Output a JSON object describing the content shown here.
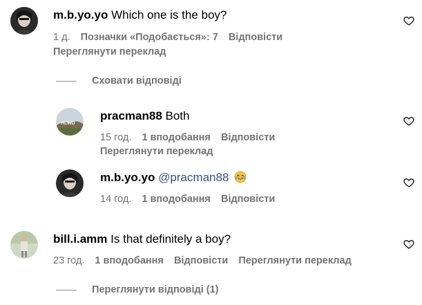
{
  "comments": [
    {
      "username": "m.b.yo.yo",
      "text": "Which one is the boy?",
      "time": "1 д.",
      "likes": "Позначки «Подобається»: 7",
      "reply": "Відповісти",
      "translate": "Переглянути переклад",
      "toggle_replies": "Сховати відповіді"
    },
    {
      "username": "bill.i.amm",
      "text": "Is that definitely a boy?",
      "time": "23 год.",
      "likes": "1 вподобання",
      "reply": "Відповісти",
      "translate": "Переглянути переклад",
      "toggle_replies": "Переглянути відповіді (1)"
    }
  ],
  "replies": [
    {
      "username": "pracman88",
      "text": "Both",
      "time": "15 год.",
      "likes": "1 вподобання",
      "reply": "Відповісти",
      "translate": "Переглянути переклад"
    },
    {
      "username": "m.b.yo.yo",
      "mention": "@pracman88",
      "emoji": "laughing-tears-emoji",
      "time": "14 год.",
      "likes": "1 вподобання",
      "reply": "Відповісти"
    }
  ],
  "colors": {
    "meta_text": "#737373",
    "mention": "#385185",
    "divider": "#8e8e8e"
  },
  "icons": [
    "heart-outline-icon",
    "laughing-tears-emoji"
  ]
}
